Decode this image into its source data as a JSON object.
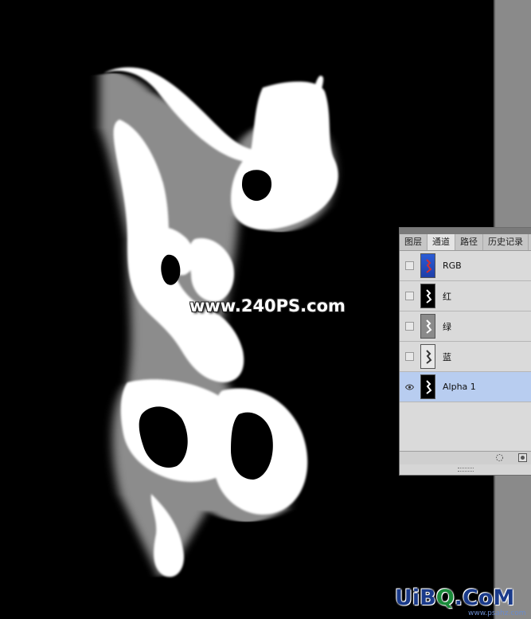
{
  "canvas": {
    "watermark": "www.240PS.com",
    "background": "#000000"
  },
  "channels_panel": {
    "tabs": [
      {
        "label": "图层",
        "active": false
      },
      {
        "label": "通道",
        "active": true
      },
      {
        "label": "路径",
        "active": false
      },
      {
        "label": "历史记录",
        "active": false
      }
    ],
    "channels": [
      {
        "label": "RGB",
        "visible": false,
        "selected": false
      },
      {
        "label": "红",
        "visible": false,
        "selected": false
      },
      {
        "label": "绿",
        "visible": false,
        "selected": false
      },
      {
        "label": "蓝",
        "visible": false,
        "selected": false
      },
      {
        "label": "Alpha 1",
        "visible": true,
        "selected": true
      }
    ],
    "footer_icons": [
      "load-selection-icon",
      "save-selection-icon"
    ],
    "selected_color": "#b8cdf0"
  },
  "logo": {
    "text_a": "UiB",
    "text_q": "Q",
    "text_b": ".CoM",
    "sub": "www.psahz.com"
  }
}
